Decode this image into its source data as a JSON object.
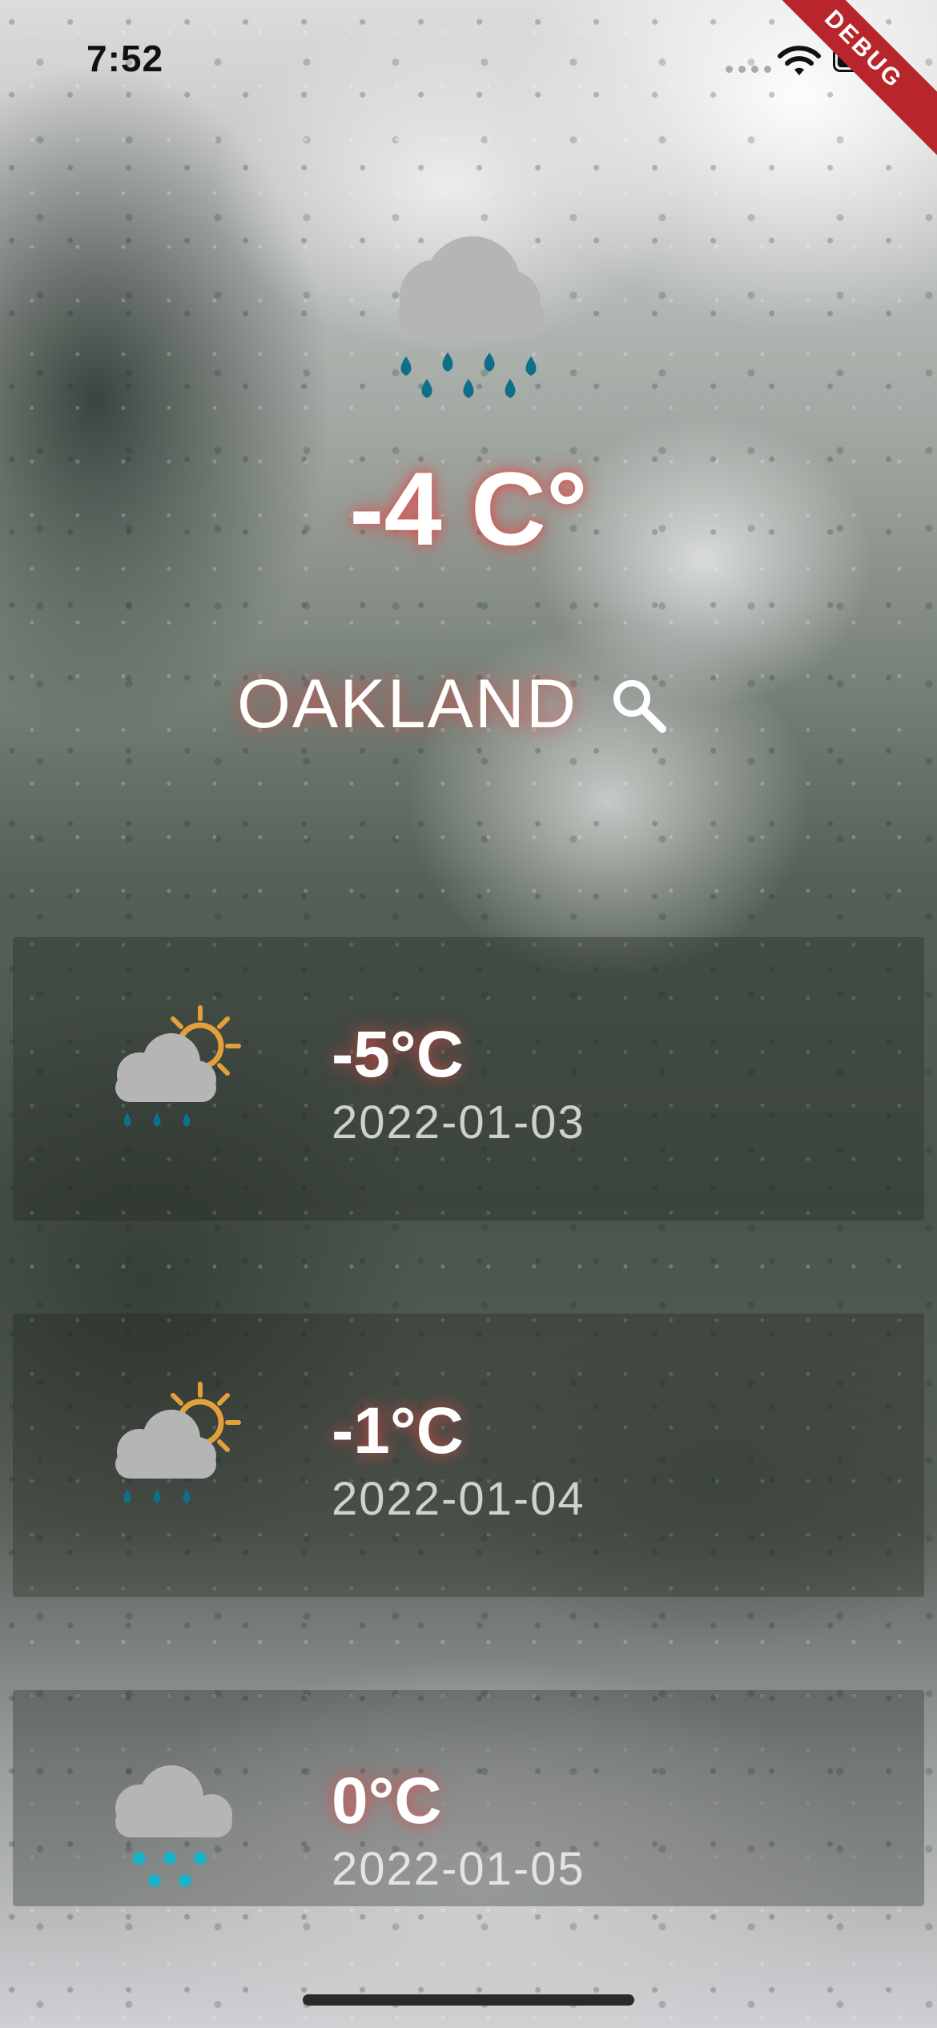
{
  "status_bar": {
    "time": "7:52",
    "debug_label": "DEBUG"
  },
  "current": {
    "icon": "rain-cloud-icon",
    "temperature": "-4 C°",
    "city": "OAKLAND",
    "search_icon": "search-icon"
  },
  "forecast": [
    {
      "icon": "partly-sunny-rain-icon",
      "temperature": "-5°C",
      "date": "2022-01-03"
    },
    {
      "icon": "partly-sunny-rain-icon",
      "temperature": "-1°C",
      "date": "2022-01-04"
    },
    {
      "icon": "sleet-cloud-icon",
      "temperature": "0°C",
      "date": "2022-01-05"
    }
  ],
  "colors": {
    "cloud": "#b5b5b5",
    "rain": "#0f6f89",
    "sleet": "#19b2c9",
    "sun": "#e2a03a",
    "glow": "#e64646"
  }
}
